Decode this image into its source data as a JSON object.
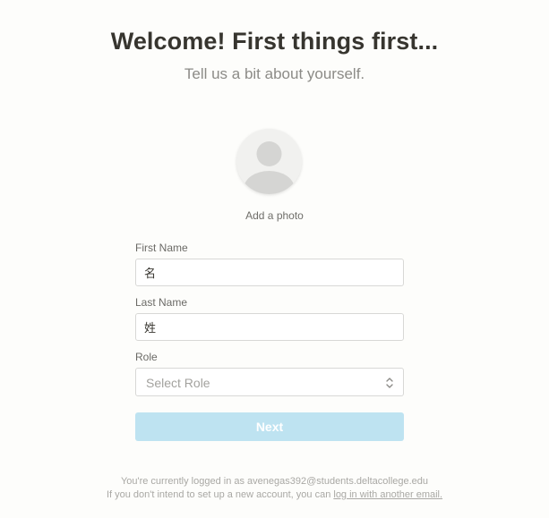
{
  "header": {
    "title": "Welcome! First things first...",
    "subtitle": "Tell us a bit about yourself."
  },
  "photo": {
    "icon": "avatar-placeholder-icon",
    "add_label": "Add a photo"
  },
  "form": {
    "first_name": {
      "label": "First Name",
      "value": "名"
    },
    "last_name": {
      "label": "Last Name",
      "value": "姓"
    },
    "role": {
      "label": "Role",
      "placeholder": "Select Role",
      "icon": "select-arrows-icon"
    },
    "next_label": "Next"
  },
  "footer": {
    "line1": "You're currently logged in as avenegas392@students.deltacollege.edu",
    "line2_prefix": "If you don't intend to set up a new account, you can ",
    "line2_link": "log in with another email."
  },
  "colors": {
    "background": "#fdfdfb",
    "next_button": "#bee3f1",
    "text": "#37352f"
  }
}
